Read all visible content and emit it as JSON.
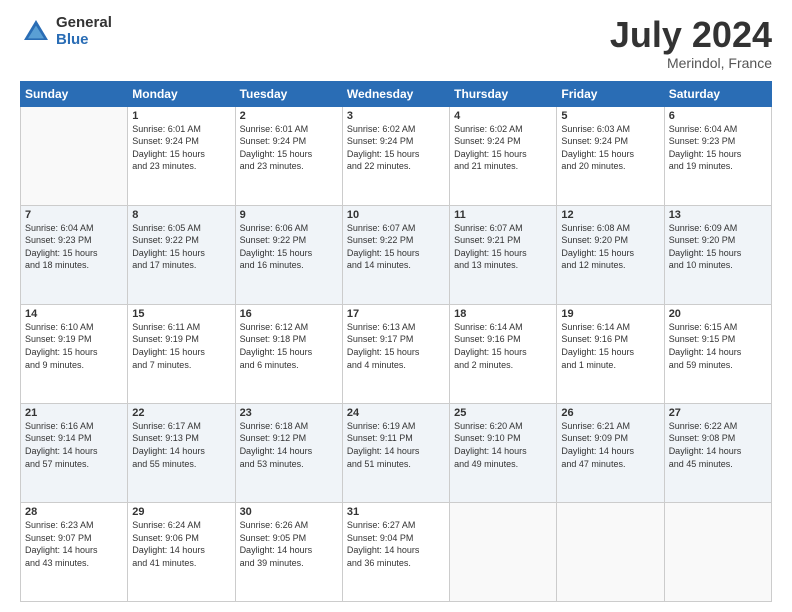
{
  "header": {
    "logo_general": "General",
    "logo_blue": "Blue",
    "title": "July 2024",
    "location": "Merindol, France"
  },
  "days_of_week": [
    "Sunday",
    "Monday",
    "Tuesday",
    "Wednesday",
    "Thursday",
    "Friday",
    "Saturday"
  ],
  "weeks": [
    [
      {
        "day": "",
        "sunrise": "",
        "sunset": "",
        "daylight": ""
      },
      {
        "day": "1",
        "sunrise": "Sunrise: 6:01 AM",
        "sunset": "Sunset: 9:24 PM",
        "daylight": "Daylight: 15 hours and 23 minutes."
      },
      {
        "day": "2",
        "sunrise": "Sunrise: 6:01 AM",
        "sunset": "Sunset: 9:24 PM",
        "daylight": "Daylight: 15 hours and 23 minutes."
      },
      {
        "day": "3",
        "sunrise": "Sunrise: 6:02 AM",
        "sunset": "Sunset: 9:24 PM",
        "daylight": "Daylight: 15 hours and 22 minutes."
      },
      {
        "day": "4",
        "sunrise": "Sunrise: 6:02 AM",
        "sunset": "Sunset: 9:24 PM",
        "daylight": "Daylight: 15 hours and 21 minutes."
      },
      {
        "day": "5",
        "sunrise": "Sunrise: 6:03 AM",
        "sunset": "Sunset: 9:24 PM",
        "daylight": "Daylight: 15 hours and 20 minutes."
      },
      {
        "day": "6",
        "sunrise": "Sunrise: 6:04 AM",
        "sunset": "Sunset: 9:23 PM",
        "daylight": "Daylight: 15 hours and 19 minutes."
      }
    ],
    [
      {
        "day": "7",
        "sunrise": "Sunrise: 6:04 AM",
        "sunset": "Sunset: 9:23 PM",
        "daylight": "Daylight: 15 hours and 18 minutes."
      },
      {
        "day": "8",
        "sunrise": "Sunrise: 6:05 AM",
        "sunset": "Sunset: 9:22 PM",
        "daylight": "Daylight: 15 hours and 17 minutes."
      },
      {
        "day": "9",
        "sunrise": "Sunrise: 6:06 AM",
        "sunset": "Sunset: 9:22 PM",
        "daylight": "Daylight: 15 hours and 16 minutes."
      },
      {
        "day": "10",
        "sunrise": "Sunrise: 6:07 AM",
        "sunset": "Sunset: 9:22 PM",
        "daylight": "Daylight: 15 hours and 14 minutes."
      },
      {
        "day": "11",
        "sunrise": "Sunrise: 6:07 AM",
        "sunset": "Sunset: 9:21 PM",
        "daylight": "Daylight: 15 hours and 13 minutes."
      },
      {
        "day": "12",
        "sunrise": "Sunrise: 6:08 AM",
        "sunset": "Sunset: 9:20 PM",
        "daylight": "Daylight: 15 hours and 12 minutes."
      },
      {
        "day": "13",
        "sunrise": "Sunrise: 6:09 AM",
        "sunset": "Sunset: 9:20 PM",
        "daylight": "Daylight: 15 hours and 10 minutes."
      }
    ],
    [
      {
        "day": "14",
        "sunrise": "Sunrise: 6:10 AM",
        "sunset": "Sunset: 9:19 PM",
        "daylight": "Daylight: 15 hours and 9 minutes."
      },
      {
        "day": "15",
        "sunrise": "Sunrise: 6:11 AM",
        "sunset": "Sunset: 9:19 PM",
        "daylight": "Daylight: 15 hours and 7 minutes."
      },
      {
        "day": "16",
        "sunrise": "Sunrise: 6:12 AM",
        "sunset": "Sunset: 9:18 PM",
        "daylight": "Daylight: 15 hours and 6 minutes."
      },
      {
        "day": "17",
        "sunrise": "Sunrise: 6:13 AM",
        "sunset": "Sunset: 9:17 PM",
        "daylight": "Daylight: 15 hours and 4 minutes."
      },
      {
        "day": "18",
        "sunrise": "Sunrise: 6:14 AM",
        "sunset": "Sunset: 9:16 PM",
        "daylight": "Daylight: 15 hours and 2 minutes."
      },
      {
        "day": "19",
        "sunrise": "Sunrise: 6:14 AM",
        "sunset": "Sunset: 9:16 PM",
        "daylight": "Daylight: 15 hours and 1 minute."
      },
      {
        "day": "20",
        "sunrise": "Sunrise: 6:15 AM",
        "sunset": "Sunset: 9:15 PM",
        "daylight": "Daylight: 14 hours and 59 minutes."
      }
    ],
    [
      {
        "day": "21",
        "sunrise": "Sunrise: 6:16 AM",
        "sunset": "Sunset: 9:14 PM",
        "daylight": "Daylight: 14 hours and 57 minutes."
      },
      {
        "day": "22",
        "sunrise": "Sunrise: 6:17 AM",
        "sunset": "Sunset: 9:13 PM",
        "daylight": "Daylight: 14 hours and 55 minutes."
      },
      {
        "day": "23",
        "sunrise": "Sunrise: 6:18 AM",
        "sunset": "Sunset: 9:12 PM",
        "daylight": "Daylight: 14 hours and 53 minutes."
      },
      {
        "day": "24",
        "sunrise": "Sunrise: 6:19 AM",
        "sunset": "Sunset: 9:11 PM",
        "daylight": "Daylight: 14 hours and 51 minutes."
      },
      {
        "day": "25",
        "sunrise": "Sunrise: 6:20 AM",
        "sunset": "Sunset: 9:10 PM",
        "daylight": "Daylight: 14 hours and 49 minutes."
      },
      {
        "day": "26",
        "sunrise": "Sunrise: 6:21 AM",
        "sunset": "Sunset: 9:09 PM",
        "daylight": "Daylight: 14 hours and 47 minutes."
      },
      {
        "day": "27",
        "sunrise": "Sunrise: 6:22 AM",
        "sunset": "Sunset: 9:08 PM",
        "daylight": "Daylight: 14 hours and 45 minutes."
      }
    ],
    [
      {
        "day": "28",
        "sunrise": "Sunrise: 6:23 AM",
        "sunset": "Sunset: 9:07 PM",
        "daylight": "Daylight: 14 hours and 43 minutes."
      },
      {
        "day": "29",
        "sunrise": "Sunrise: 6:24 AM",
        "sunset": "Sunset: 9:06 PM",
        "daylight": "Daylight: 14 hours and 41 minutes."
      },
      {
        "day": "30",
        "sunrise": "Sunrise: 6:26 AM",
        "sunset": "Sunset: 9:05 PM",
        "daylight": "Daylight: 14 hours and 39 minutes."
      },
      {
        "day": "31",
        "sunrise": "Sunrise: 6:27 AM",
        "sunset": "Sunset: 9:04 PM",
        "daylight": "Daylight: 14 hours and 36 minutes."
      },
      {
        "day": "",
        "sunrise": "",
        "sunset": "",
        "daylight": ""
      },
      {
        "day": "",
        "sunrise": "",
        "sunset": "",
        "daylight": ""
      },
      {
        "day": "",
        "sunrise": "",
        "sunset": "",
        "daylight": ""
      }
    ]
  ]
}
